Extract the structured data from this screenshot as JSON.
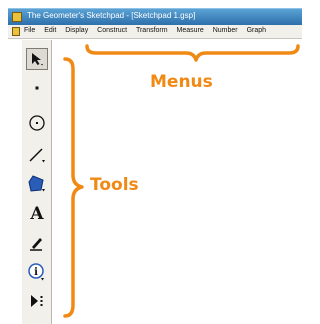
{
  "window": {
    "title": "The Geometer's Sketchpad - [Sketchpad 1.gsp]"
  },
  "menubar": {
    "items": [
      "File",
      "Edit",
      "Display",
      "Construct",
      "Transform",
      "Measure",
      "Number",
      "Graph"
    ]
  },
  "toolbox": {
    "tools": [
      {
        "name": "selection-arrow-tool",
        "icon": "arrow-icon",
        "selected": true
      },
      {
        "name": "point-tool",
        "icon": "point-icon"
      },
      {
        "name": "compass-tool",
        "icon": "circle-icon"
      },
      {
        "name": "straightedge-tool",
        "icon": "line-segment-icon"
      },
      {
        "name": "polygon-tool",
        "icon": "polygon-icon"
      },
      {
        "name": "text-tool",
        "icon": "text-A-icon",
        "glyph": "A"
      },
      {
        "name": "marker-tool",
        "icon": "pen-icon"
      },
      {
        "name": "information-tool",
        "icon": "info-icon"
      },
      {
        "name": "custom-tool",
        "icon": "play-dots-icon"
      }
    ]
  },
  "annotations": {
    "menus_label": "Menus",
    "tools_label": "Tools",
    "color": "#f08a14"
  }
}
